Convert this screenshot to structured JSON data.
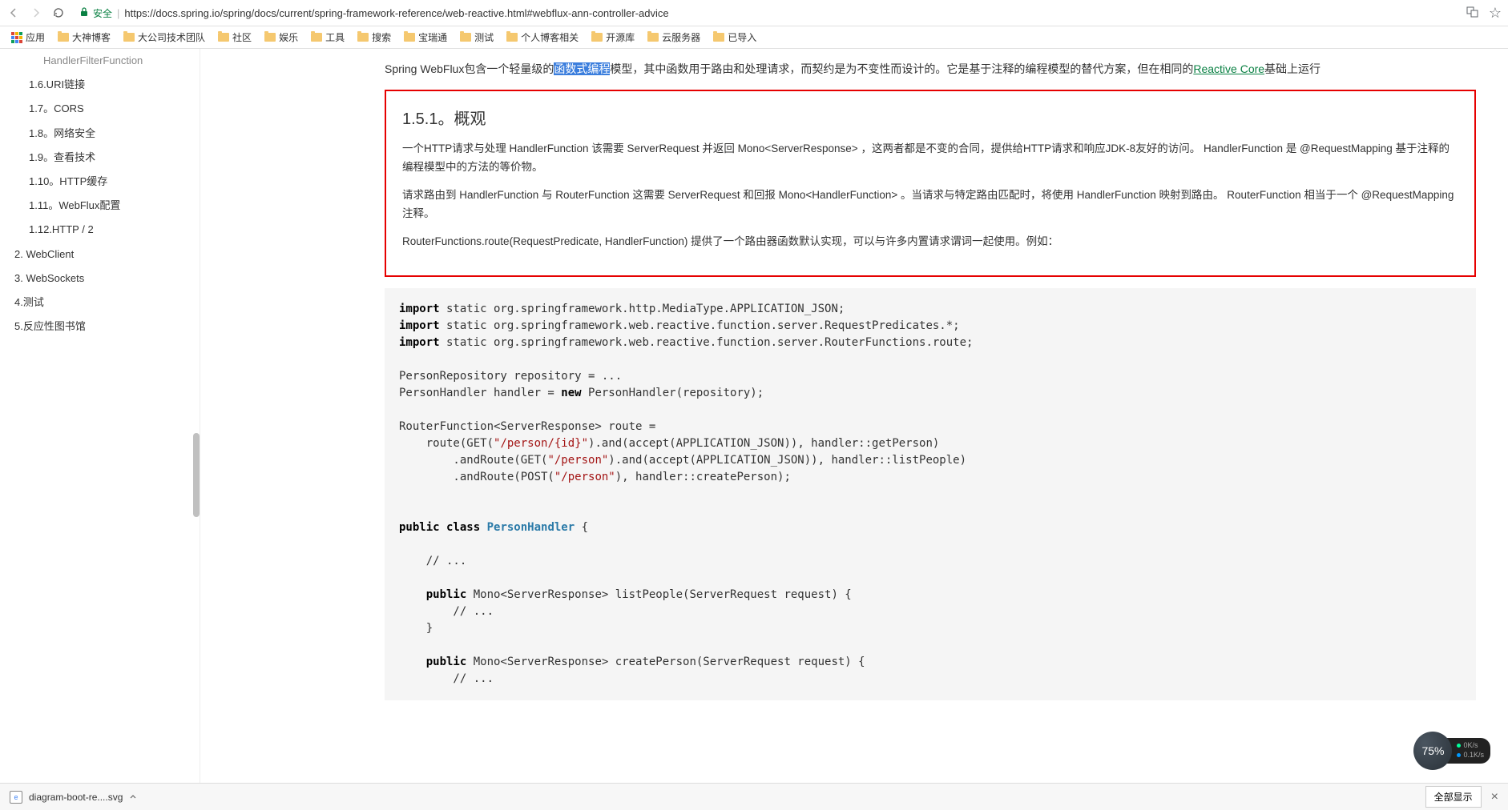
{
  "browser": {
    "secure_label": "安全",
    "url": "https://docs.spring.io/spring/docs/current/spring-framework-reference/web-reactive.html#webflux-ann-controller-advice"
  },
  "bookmarks": {
    "apps": "应用",
    "items": [
      "大神博客",
      "大公司技术团队",
      "社区",
      "娱乐",
      "工具",
      "搜索",
      "宝瑞通",
      "测试",
      "个人博客相关",
      "开源库",
      "云服务器",
      "已导入"
    ]
  },
  "sidebar": {
    "partial": "HandlerFilterFunction",
    "items": [
      "1.6.URI链接",
      "1.7。CORS",
      "1.8。网络安全",
      "1.9。查看技术",
      "1.10。HTTP缓存",
      "1.11。WebFlux配置",
      "1.12.HTTP / 2"
    ],
    "top_level": [
      "2. WebClient",
      "3. WebSockets",
      "4.测试",
      "5.反应性图书馆"
    ]
  },
  "content": {
    "intro_prefix": "Spring WebFlux包含一个轻量级的",
    "intro_highlight": "函数式编程",
    "intro_mid": "模型，其中函数用于路由和处理请求，而契约是为不变性而设计的。它是基于注释的编程模型的替代方案，但在相同的",
    "intro_link": "Reactive Core",
    "intro_suffix": "基础上运行",
    "section_heading": "1.5.1。概观",
    "para1": "一个HTTP请求与处理 HandlerFunction 该需要 ServerRequest 并返回 Mono<ServerResponse> ，这两者都是不变的合同，提供给HTTP请求和响应JDK-8友好的访问。 HandlerFunction 是 @RequestMapping 基于注释的编程模型中的方法的等价物。",
    "para2": "请求路由到 HandlerFunction 与 RouterFunction 这需要 ServerRequest 和回报 Mono<HandlerFunction> 。当请求与特定路由匹配时，将使用 HandlerFunction 映射到路由。 RouterFunction 相当于一个 @RequestMapping 注释。",
    "para3": "RouterFunctions.route(RequestPredicate, HandlerFunction) 提供了一个路由器函数默认实现，可以与许多内置请求谓词一起使用。例如："
  },
  "code": {
    "import1a": "import",
    "import1b": " static org.springframework.http.MediaType.APPLICATION_JSON;",
    "import2a": "import",
    "import2b": " static org.springframework.web.reactive.function.server.RequestPredicates.*;",
    "import3a": "import",
    "import3b": " static org.springframework.web.reactive.function.server.RouterFunctions.route;",
    "line4": "PersonRepository repository = ...",
    "line5a": "PersonHandler handler = ",
    "line5b": "new",
    "line5c": " PersonHandler(repository);",
    "line6": "RouterFunction<ServerResponse> route =",
    "line7a": "    route(GET(",
    "line7s": "\"/person/{id}\"",
    "line7b": ").and(accept(APPLICATION_JSON)), handler::getPerson)",
    "line8a": "        .andRoute(GET(",
    "line8s": "\"/person\"",
    "line8b": ").and(accept(APPLICATION_JSON)), handler::listPeople)",
    "line9a": "        .andRoute(POST(",
    "line9s": "\"/person\"",
    "line9b": "), handler::createPerson);",
    "line10a": "public",
    "line10b": " class",
    "line10c": " PersonHandler",
    "line10d": " {",
    "line11": "    // ...",
    "line12a": "    public",
    "line12b": " Mono<ServerResponse> listPeople(ServerRequest request) {",
    "line13": "        // ...",
    "line14": "    }",
    "line15a": "    public",
    "line15b": " Mono<ServerResponse> createPerson(ServerRequest request) {",
    "line16": "        // ..."
  },
  "bottom": {
    "filename": "diagram-boot-re....svg",
    "show_all": "全部显示"
  },
  "widget": {
    "percent": "75%",
    "up": "0K/s",
    "down": "0.1K/s"
  }
}
